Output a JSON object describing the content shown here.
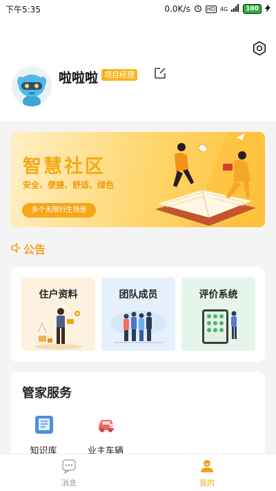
{
  "status_bar": {
    "time": "下午5:35",
    "speed": "0.0K/s",
    "hd": "HD",
    "signal": "4G",
    "battery": "100"
  },
  "profile": {
    "name": "啦啦啦",
    "role": "项目经理",
    "settings_icon": "hexagon-settings-icon",
    "edit_icon": "edit-icon"
  },
  "banner": {
    "title": "智慧社区",
    "subtitle": "安全、便捷、舒适、绿色",
    "button": "多个无限衍生场景"
  },
  "notice": {
    "label": "公告",
    "icon": "speaker-icon"
  },
  "functions": [
    {
      "label": "住户资料"
    },
    {
      "label": "团队成员"
    },
    {
      "label": "评价系统"
    }
  ],
  "service": {
    "title": "管家服务",
    "items": [
      {
        "label": "知识库",
        "icon": "book-icon"
      },
      {
        "label": "业主车辆",
        "icon": "car-icon"
      }
    ]
  },
  "tabbar": {
    "tabs": [
      {
        "label": "消息",
        "icon": "chat-icon",
        "active": false
      },
      {
        "label": "我的",
        "icon": "person-icon",
        "active": true
      }
    ]
  },
  "colors": {
    "accent": "#f3a117",
    "badge": "#f9b41b"
  }
}
